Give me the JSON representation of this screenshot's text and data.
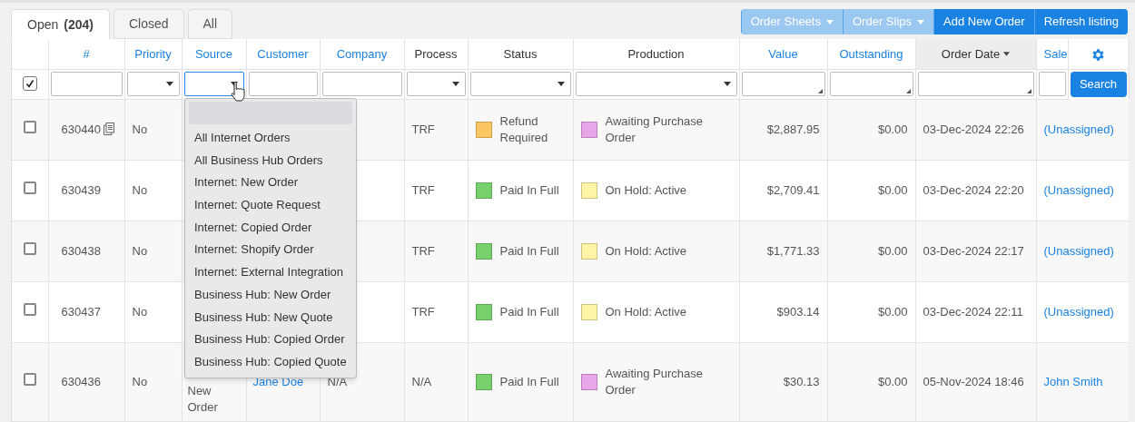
{
  "tabs": [
    {
      "label": "Open",
      "count": "(204)",
      "selected": true
    },
    {
      "label": "Closed",
      "selected": false
    },
    {
      "label": "All",
      "selected": false
    }
  ],
  "toolbar": [
    {
      "label": "Order Sheets",
      "has_menu": true,
      "disabled": true
    },
    {
      "label": "Order Slips",
      "has_menu": true,
      "disabled": true
    },
    {
      "label": "Add New Order",
      "has_menu": false,
      "disabled": false
    },
    {
      "label": "Refresh listing",
      "has_menu": false,
      "disabled": false
    }
  ],
  "columns": [
    {
      "kind": "check"
    },
    {
      "kind": "text",
      "label": "#",
      "sortable": true,
      "sorted": false
    },
    {
      "kind": "text",
      "label": "Priority",
      "sortable": true,
      "sorted": false
    },
    {
      "kind": "text",
      "label": "Source",
      "sortable": true,
      "sorted": false
    },
    {
      "kind": "text",
      "label": "Customer",
      "sortable": true,
      "sorted": false
    },
    {
      "kind": "text",
      "label": "Company",
      "sortable": true,
      "sorted": false
    },
    {
      "kind": "text",
      "label": "Process",
      "sortable": false,
      "sorted": false
    },
    {
      "kind": "text",
      "label": "Status",
      "sortable": false,
      "sorted": false
    },
    {
      "kind": "text",
      "label": "Production",
      "sortable": false,
      "sorted": false
    },
    {
      "kind": "text",
      "label": "Value",
      "sortable": true,
      "sorted": false
    },
    {
      "kind": "text",
      "label": "Outstanding",
      "sortable": true,
      "sorted": false
    },
    {
      "kind": "text",
      "label": "Order Date",
      "sortable": true,
      "sorted": true
    },
    {
      "kind": "text",
      "label": "Sale",
      "sortable": true,
      "sorted": false
    },
    {
      "kind": "settings"
    }
  ],
  "filters": [
    {
      "kind": "checkbox",
      "checked": true
    },
    {
      "kind": "input"
    },
    {
      "kind": "select",
      "open": false
    },
    {
      "kind": "select",
      "open": true
    },
    {
      "kind": "input"
    },
    {
      "kind": "input"
    },
    {
      "kind": "select",
      "open": false
    },
    {
      "kind": "select",
      "open": false
    },
    {
      "kind": "select",
      "open": false
    },
    {
      "kind": "textarea"
    },
    {
      "kind": "textarea"
    },
    {
      "kind": "textarea"
    },
    {
      "kind": "input"
    },
    {
      "kind": "button",
      "label": "Search"
    }
  ],
  "source_menu": {
    "blank_highlighted": true,
    "options": [
      "All Internet Orders",
      "All Business Hub Orders",
      "Internet: New Order",
      "Internet: Quote Request",
      "Internet: Copied Order",
      "Internet: Shopify Order",
      "Internet: External Integration",
      "Business Hub: New Order",
      "Business Hub: New Quote",
      "Business Hub: Copied Order",
      "Business Hub: Copied Quote"
    ]
  },
  "rows": [
    {
      "checked": false,
      "number": "630440",
      "note": true,
      "priority": "No",
      "process": "TRF",
      "status": {
        "label": "Refund Required",
        "color": "#fcc762"
      },
      "production": {
        "label": "Awaiting Purchase Order",
        "color": "#e8a6e8"
      },
      "value": "$2,887.95",
      "outstanding": "$0.00",
      "order_date": "03-Dec-2024 22:26",
      "salesperson": "(Unassigned)"
    },
    {
      "checked": false,
      "number": "630439",
      "note": false,
      "priority": "No",
      "process": "TRF",
      "status": {
        "label": "Paid In Full",
        "color": "#77d06c"
      },
      "production": {
        "label": "On Hold: Active",
        "color": "#fff3a6"
      },
      "value": "$2,709.41",
      "outstanding": "$0.00",
      "order_date": "03-Dec-2024 22:20",
      "salesperson": "(Unassigned)"
    },
    {
      "checked": false,
      "number": "630438",
      "note": false,
      "priority": "No",
      "process": "TRF",
      "status": {
        "label": "Paid In Full",
        "color": "#77d06c"
      },
      "production": {
        "label": "On Hold: Active",
        "color": "#fff3a6"
      },
      "value": "$1,771.33",
      "outstanding": "$0.00",
      "order_date": "03-Dec-2024 22:17",
      "salesperson": "(Unassigned)"
    },
    {
      "checked": false,
      "number": "630437",
      "note": false,
      "priority": "No",
      "process": "TRF",
      "status": {
        "label": "Paid In Full",
        "color": "#77d06c"
      },
      "production": {
        "label": "On Hold: Active",
        "color": "#fff3a6"
      },
      "value": "$903.14",
      "outstanding": "$0.00",
      "order_date": "03-Dec-2024 22:11",
      "salesperson": "(Unassigned)"
    },
    {
      "checked": false,
      "number": "630436",
      "note": false,
      "priority": "No",
      "source": "New Order",
      "customer": "Jane Doe",
      "company": "N/A",
      "process": "N/A",
      "status": {
        "label": "Paid In Full",
        "color": "#77d06c"
      },
      "production": {
        "label": "Awaiting Purchase Order",
        "color": "#e8a6e8"
      },
      "value": "$30.13",
      "outstanding": "$0.00",
      "order_date": "05-Nov-2024 18:46",
      "salesperson": "John Smith"
    }
  ]
}
